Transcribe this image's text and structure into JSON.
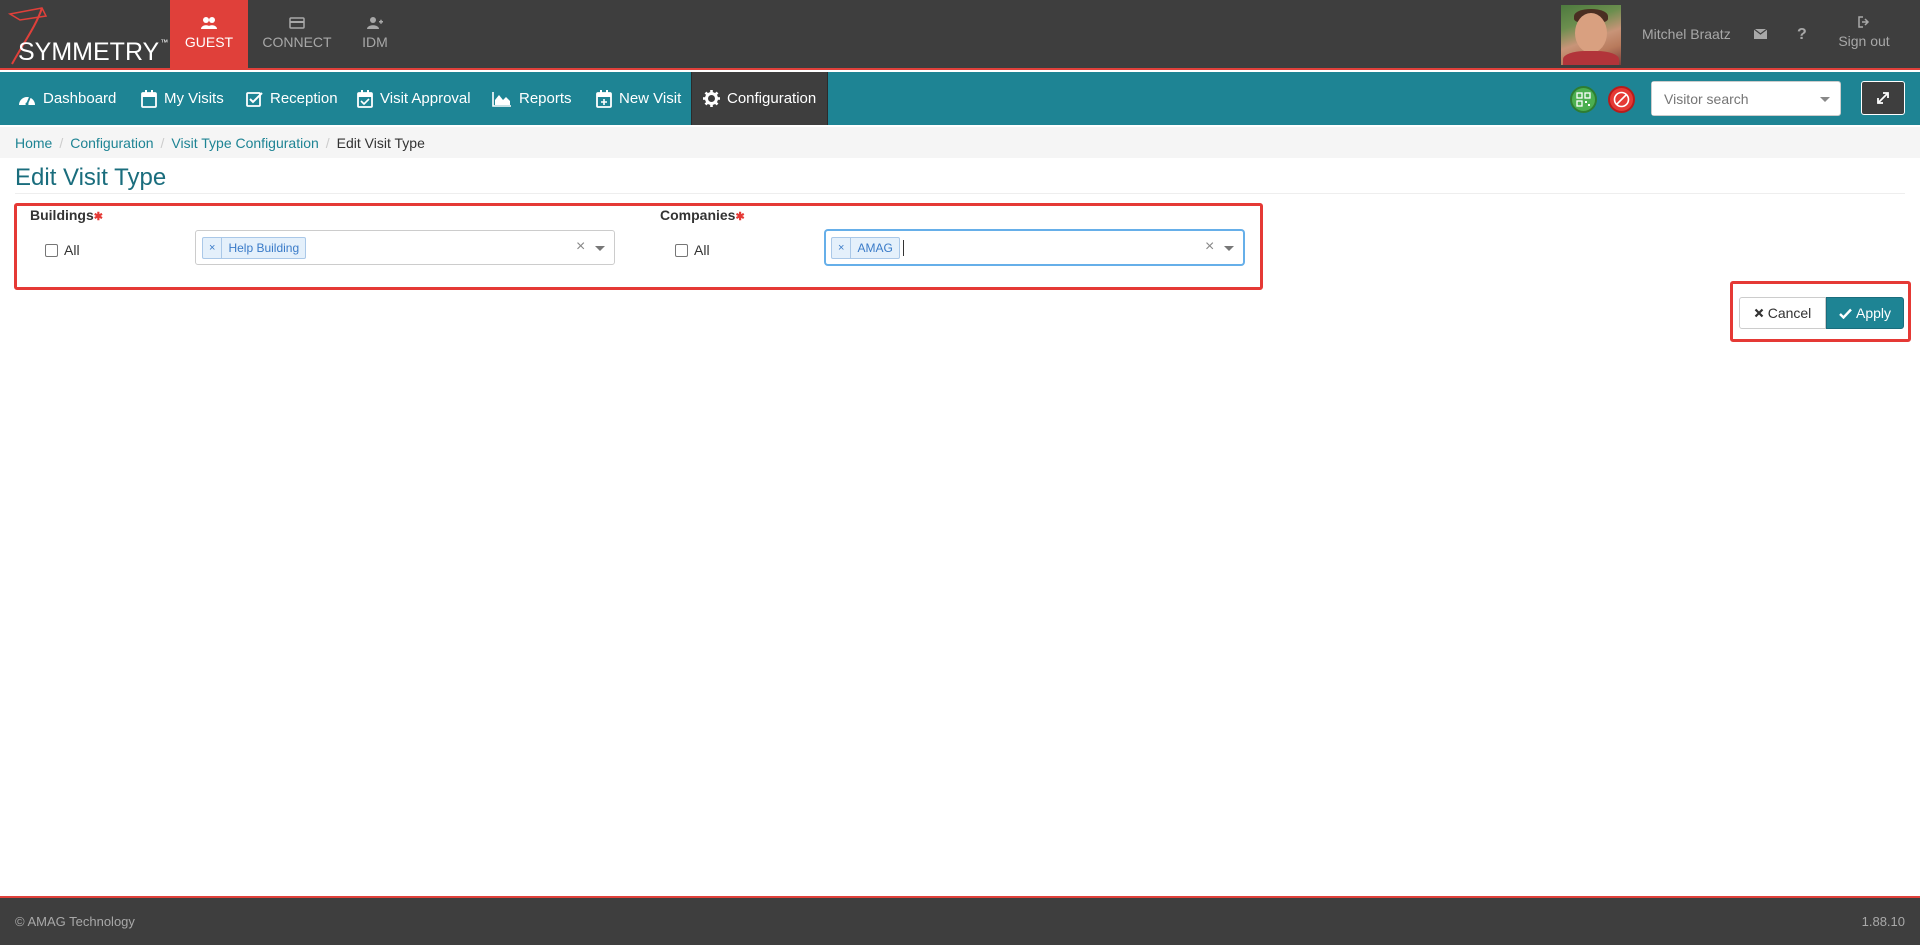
{
  "header": {
    "logo_text": "SYMMETRY",
    "logo_tm": "™",
    "app_tabs": [
      {
        "label": "GUEST",
        "icon": "guest-icon",
        "active": true
      },
      {
        "label": "CONNECT",
        "icon": "card-icon",
        "active": false
      },
      {
        "label": "IDM",
        "icon": "user-plus-icon",
        "active": false
      }
    ],
    "user_name": "Mitchel Braatz",
    "help_label": "?",
    "signout_label": "Sign out"
  },
  "nav": {
    "items": [
      {
        "label": "Dashboard",
        "icon": "dashboard-icon"
      },
      {
        "label": "My Visits",
        "icon": "calendar-icon"
      },
      {
        "label": "Reception",
        "icon": "checkbox-icon"
      },
      {
        "label": "Visit Approval",
        "icon": "calendar-check-icon"
      },
      {
        "label": "Reports",
        "icon": "area-chart-icon"
      },
      {
        "label": "New Visit",
        "icon": "calendar-plus-icon"
      },
      {
        "label": "Configuration",
        "icon": "gear-icon",
        "active": true
      }
    ],
    "visitor_search_placeholder": "Visitor search"
  },
  "breadcrumb": {
    "items": [
      "Home",
      "Configuration",
      "Visit Type Configuration"
    ],
    "current": "Edit Visit Type",
    "separator": "/"
  },
  "page": {
    "title": "Edit Visit Type"
  },
  "form": {
    "required_mark": "✱",
    "buildings": {
      "label": "Buildings",
      "all_label": "All",
      "all_checked": false,
      "tags": [
        "Help Building"
      ]
    },
    "companies": {
      "label": "Companies",
      "all_label": "All",
      "all_checked": false,
      "tags": [
        "AMAG"
      ]
    },
    "tag_remove": "×",
    "clear_label": "×",
    "cancel_label": "Cancel",
    "apply_label": "Apply"
  },
  "footer": {
    "copyright": "© AMAG Technology",
    "version": "1.88.10"
  },
  "colors": {
    "header_bg": "#3e3e3e",
    "accent_red": "#e0403a",
    "nav_teal": "#1e8494",
    "title_teal": "#1a6d7d",
    "highlight_red": "#e53935"
  }
}
